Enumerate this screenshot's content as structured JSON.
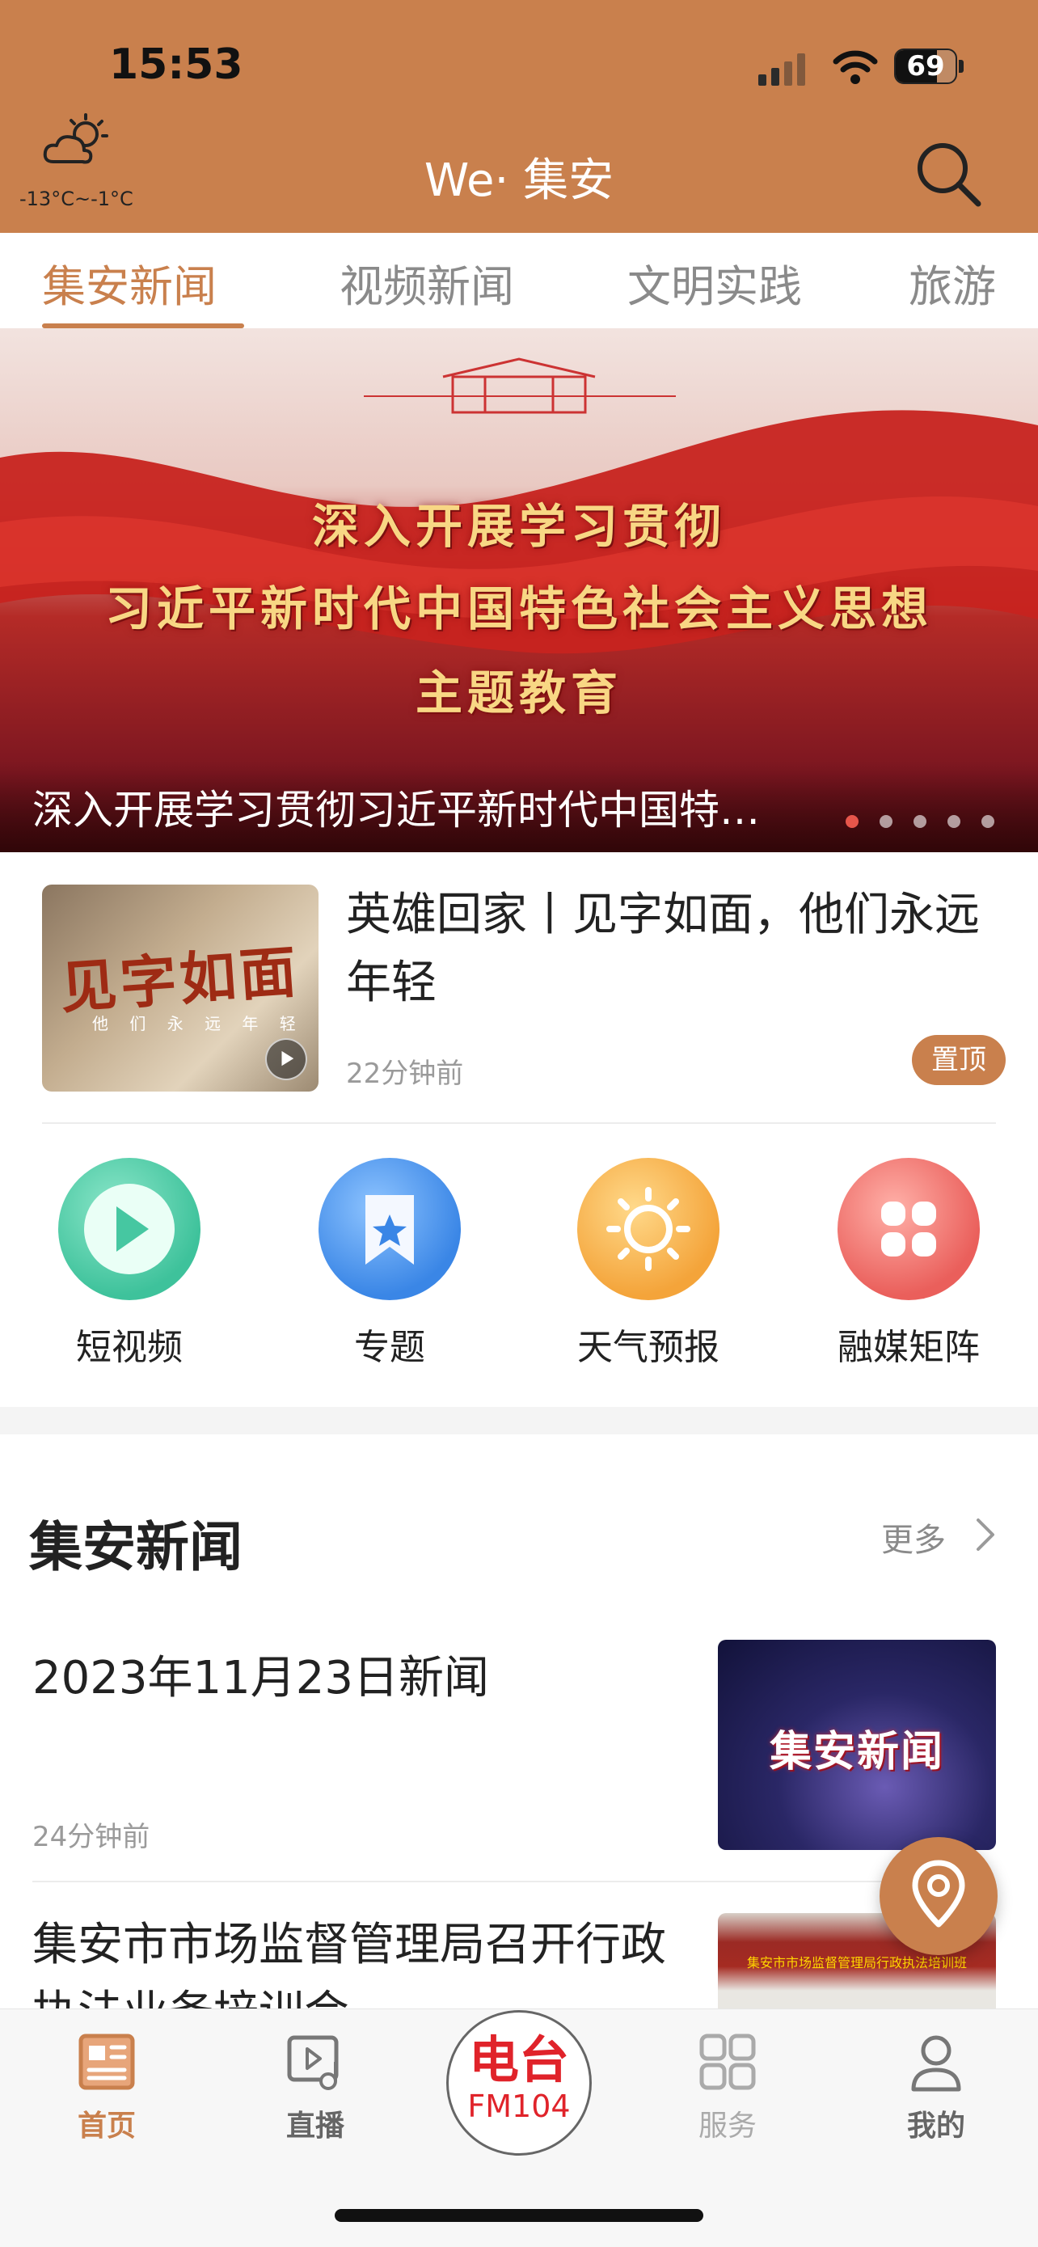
{
  "status_bar": {
    "time": "15:53",
    "battery": "69",
    "battery_level": 0.69
  },
  "header": {
    "weather_range": "-13°C~-1°C",
    "title": "We· 集安"
  },
  "tabs": [
    {
      "label": "集安新闻",
      "active": true
    },
    {
      "label": "视频新闻",
      "active": false
    },
    {
      "label": "文明实践",
      "active": false
    },
    {
      "label": "旅游",
      "active": false
    }
  ],
  "banner": {
    "lines": [
      "深入开展学习贯彻",
      "习近平新时代中国特色社会主义思想",
      "主题教育"
    ],
    "caption": "深入开展学习贯彻习近平新时代中国特…",
    "slide_count": 5,
    "active_slide": 1
  },
  "featured": {
    "title": "英雄回家丨见字如面，他们永远年轻",
    "thumb_text": "见字如面",
    "thumb_sub": "他 们 永 远 年 轻",
    "time": "22分钟前",
    "badge": "置顶"
  },
  "quick_entries": [
    {
      "label": "短视频",
      "icon": "play-icon"
    },
    {
      "label": "专题",
      "icon": "bookmark-star-icon"
    },
    {
      "label": "天气预报",
      "icon": "sun-icon"
    },
    {
      "label": "融媒矩阵",
      "icon": "grid-icon"
    }
  ],
  "news_section": {
    "title": "集安新闻",
    "more": "更多",
    "items": [
      {
        "title": "2023年11月23日新闻",
        "time": "24分钟前",
        "thumb_text": "集安新闻"
      },
      {
        "title": "集安市市场监督管理局召开行政执法业务培训会",
        "thumb_text": "集安市市场监督管理局行政执法培训班"
      }
    ]
  },
  "tabbar": [
    {
      "label": "首页",
      "icon": "news-icon",
      "active": true
    },
    {
      "label": "直播",
      "icon": "live-icon",
      "active": false
    },
    {
      "label": "服务",
      "icon": "services-icon",
      "active": false
    },
    {
      "label": "我的",
      "icon": "profile-icon",
      "active": false
    }
  ],
  "radio": {
    "title": "电台",
    "freq": "FM104"
  },
  "colors": {
    "accent": "#c9804d",
    "radio_red": "#e0232a"
  }
}
